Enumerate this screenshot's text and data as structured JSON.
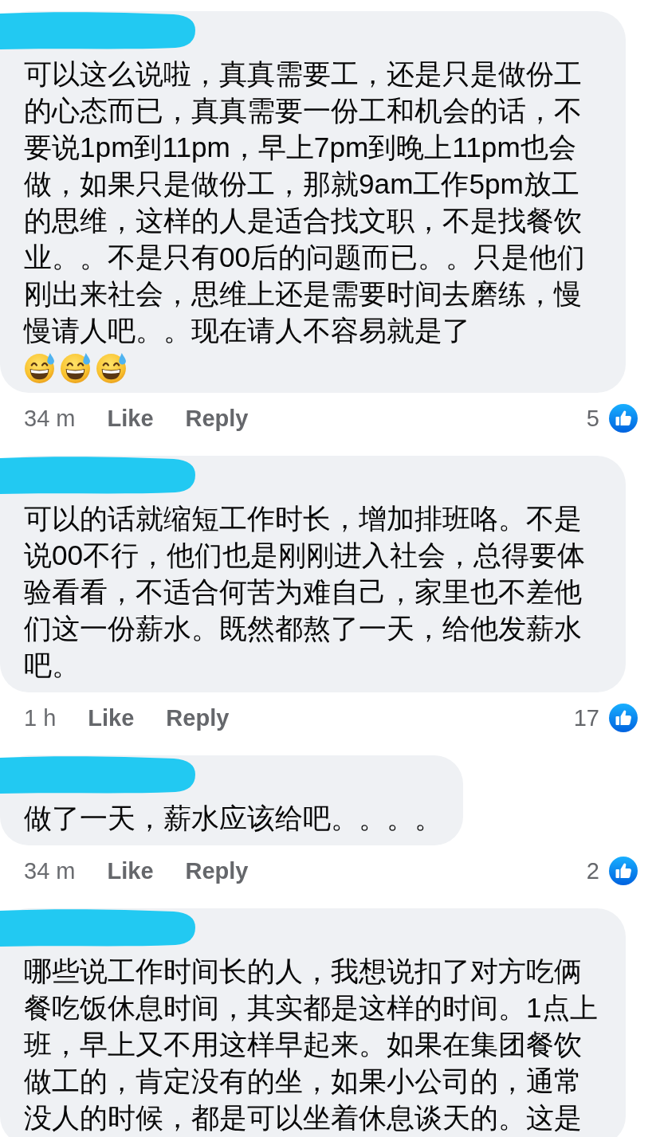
{
  "comments": [
    {
      "text": "可以这么说啦，真真需要工，还是只是做份工的心态而已，真真需要一份工和机会的话，不要说1pm到11pm，早上7pm到晚上11pm也会做，如果只是做份工，那就9am工作5pm放工的思维，这样的人是适合找文职，不是找餐饮业。。不是只有00后的问题而已。。只是他们刚出来社会，思维上还是需要时间去磨练，慢慢请人吧。。现在请人不容易就是了",
      "emojis": [
        {
          "kind": "sweat-smile"
        },
        {
          "kind": "sweat-smile"
        },
        {
          "kind": "sweat-smile"
        }
      ],
      "time": "34 m",
      "actions": [
        "Like",
        "Reply"
      ],
      "reaction_count": "5"
    },
    {
      "text": "可以的话就缩短工作时长，增加排班咯。不是说00不行，他们也是刚刚进入社会，总得要体验看看，不适合何苦为难自己，家里也不差他们这一份薪水。既然都熬了一天，给他发薪水吧。",
      "time": "1 h",
      "actions": [
        "Like",
        "Reply"
      ],
      "reaction_count": "17"
    },
    {
      "text": "做了一天，薪水应该给吧。。。。",
      "time": "34 m",
      "actions": [
        "Like",
        "Reply"
      ],
      "reaction_count": "2"
    },
    {
      "text": "哪些说工作时间长的人，我想说扣了对方吃俩餐吃饭休息时间，其实都是这样的时间。1点上班，早上又不用这样早起来。如果在集团餐饮做工的，肯定没有的坐，如果小公司的，通常没人的时候，都是可以坐着休息谈天的。这是"
    }
  ]
}
